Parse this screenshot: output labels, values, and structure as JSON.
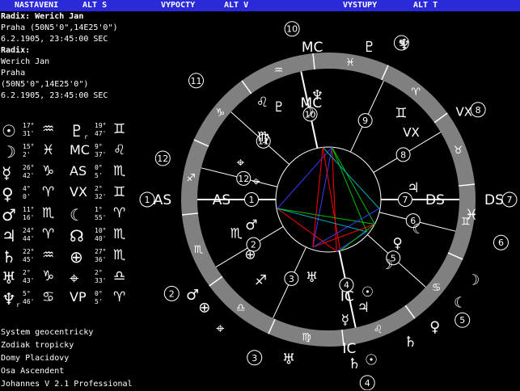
{
  "menu": [
    "NASTAVENI",
    "ALT S",
    "VYPOCTY",
    "ALT V",
    "VYSTUPY",
    "ALT T"
  ],
  "header": {
    "radix1_label": "Radix: Werich Jan",
    "place1": "Praha (50N5'0\",14E25'0\")",
    "datetime1": "6.2.1905, 23:45:00 SEC",
    "radix2_label": "Radix:",
    "name2": "Werich Jan",
    "city2": "Praha",
    "coords2": "(50N5'0\",14E25'0\")",
    "datetime2": "6.2.1905, 23:45:00 SEC"
  },
  "positions": [
    {
      "planet": "☉",
      "deg": "17°",
      "min": "31'",
      "sign": "♒",
      "planet2": "♇",
      "sub2": "r",
      "deg2": "19°",
      "min2": "47'",
      "sign2": "♊"
    },
    {
      "planet": "☽",
      "deg": "15°",
      "min": "2'",
      "sign": "♓",
      "planet2": "MC",
      "sub2": "",
      "deg2": "9°",
      "min2": "37'",
      "sign2": "♌"
    },
    {
      "planet": "☿",
      "deg": "26°",
      "min": "42'",
      "sign": "♑",
      "planet2": "AS",
      "sub2": "",
      "deg2": "0°",
      "min2": "5'",
      "sign2": "♏"
    },
    {
      "planet": "♀",
      "deg": "4°",
      "min": "0'",
      "sign": "♈",
      "planet2": "VX",
      "sub2": "",
      "deg2": "2°",
      "min2": "32'",
      "sign2": "♊"
    },
    {
      "planet": "♂",
      "deg": "11°",
      "min": "16'",
      "sign": "♏",
      "planet2": "☾",
      "sub2": "",
      "deg2": "1°",
      "min2": "55'",
      "sign2": "♈"
    },
    {
      "planet": "♃",
      "deg": "24°",
      "min": "44'",
      "sign": "♈",
      "planet2": "☊",
      "sub2": "",
      "deg2": "10°",
      "min2": "40'",
      "sign2": "♏"
    },
    {
      "planet": "♄",
      "deg": "22°",
      "min": "45'",
      "sign": "♒",
      "planet2": "⊕",
      "sub2": "",
      "deg2": "27°",
      "min2": "36'",
      "sign2": "♏"
    },
    {
      "planet": "♅",
      "deg": "2°",
      "min": "43'",
      "sign": "♑",
      "planet2": "⌖",
      "sub2": "",
      "deg2": "2°",
      "min2": "33'",
      "sign2": "♎"
    },
    {
      "planet": "♆",
      "sub": "r",
      "deg": "5°",
      "min": "46'",
      "sign": "♋",
      "planet2": "VP",
      "sub2": "",
      "deg2": "0°",
      "min2": "5'",
      "sign2": "♈"
    }
  ],
  "footer": {
    "system": "System geocentricky",
    "zodiac": "Zodiak tropicky",
    "houses": "Domy Placidovy",
    "axis": "Osa Ascendent",
    "version": "Johannes V 2.1 Professional"
  },
  "colors": {
    "menu_bg": "#2a2ad8",
    "ring": "#808080",
    "aspect_red": "#ff0000",
    "aspect_blue": "#3a3aff",
    "aspect_green": "#00c000",
    "aspect_cyan": "#00b0b0"
  }
}
